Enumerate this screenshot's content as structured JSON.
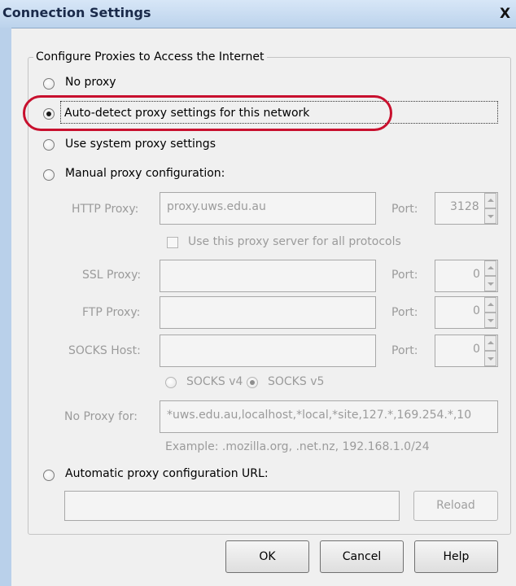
{
  "window": {
    "title": "Connection Settings",
    "close_glyph": "X"
  },
  "group": {
    "title": "Configure Proxies to Access the Internet"
  },
  "options": {
    "no_proxy": "No proxy",
    "auto_detect": "Auto-detect proxy settings for this network",
    "system_proxy": "Use system proxy settings",
    "manual": "Manual proxy configuration:",
    "selected": "auto_detect"
  },
  "manual": {
    "http_label": "HTTP Proxy:",
    "http_value": "proxy.uws.edu.au",
    "http_port_label": "Port:",
    "http_port_value": "3128",
    "share_label": "Use this proxy server for all protocols",
    "ssl_label": "SSL Proxy:",
    "ssl_value": "",
    "ssl_port_label": "Port:",
    "ssl_port_value": "0",
    "ftp_label": "FTP Proxy:",
    "ftp_value": "",
    "ftp_port_label": "Port:",
    "ftp_port_value": "0",
    "socks_label": "SOCKS Host:",
    "socks_value": "",
    "socks_port_label": "Port:",
    "socks_port_value": "0",
    "socks_v4": "SOCKS v4",
    "socks_v5": "SOCKS v5",
    "no_proxy_label": "No Proxy for:",
    "no_proxy_value": "*uws.edu.au,localhost,*local,*site,127.*,169.254.*,10",
    "example": "Example: .mozilla.org, .net.nz, 192.168.1.0/24"
  },
  "auto_config": {
    "label": "Automatic proxy configuration URL:",
    "url_value": "",
    "reload_label": "Reload"
  },
  "buttons": {
    "ok": "OK",
    "cancel": "Cancel",
    "help": "Help"
  },
  "colors": {
    "highlight": "#c8102e",
    "titlebar": "#bcd3ec",
    "disabled_text": "#9b9b9b"
  }
}
